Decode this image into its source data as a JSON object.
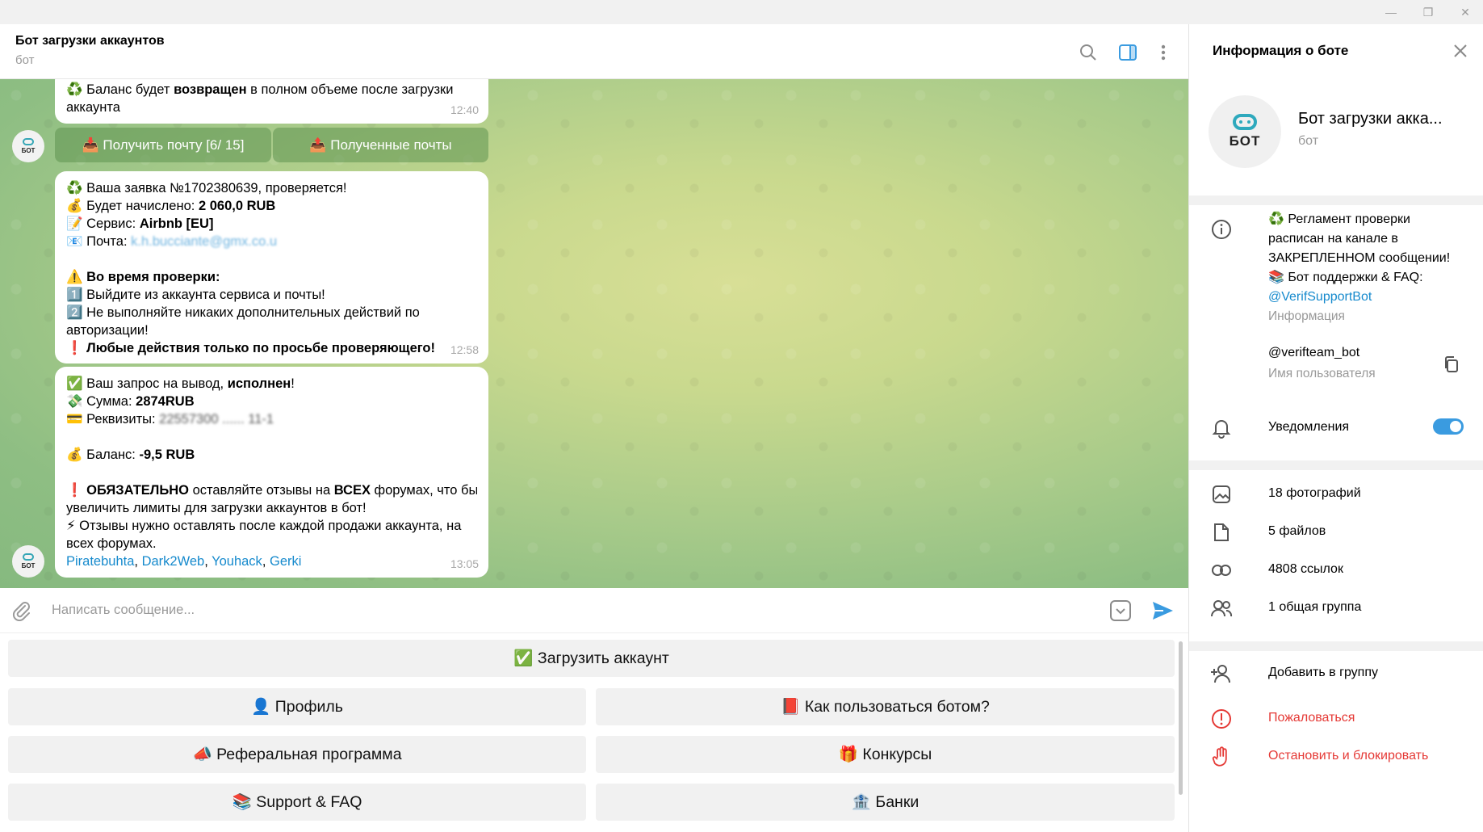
{
  "window": {
    "minimize": "—",
    "maximize": "❐",
    "close": "✕"
  },
  "header": {
    "title": "Бот загрузки аккаунтов",
    "status": "бот"
  },
  "chat": {
    "msg1": {
      "line1_emoji": "♻️",
      "line1_pre": " Баланс будет ",
      "line1_bold": "возвращен",
      "line1_post": " в полном объеме после загрузки",
      "line2": "аккаунта",
      "time": "12:40"
    },
    "inline_buttons": [
      {
        "label": "📥 Получить почту [6/ 15]"
      },
      {
        "label": "📤 Полученные почты"
      }
    ],
    "msg2": {
      "l1_pre": "♻️ Ваша заявка №1702380639, проверяется!",
      "l2_pre": "💰 Будет начислено: ",
      "l2_bold": "2 060,0 RUB",
      "l3_pre": "📝 Сервис: ",
      "l3_bold": "Airbnb [EU]",
      "l4_pre": "📧 Почта: ",
      "l4_blur": "k.h.bucciante@gmx.co.u",
      "l5_pre": "⚠️ ",
      "l5_bold": "Во время проверки:",
      "l6": "1️⃣ Выйдите из аккаунта сервиса и почты!",
      "l7": "2️⃣ Не выполняйте никаких дополнительных действий по",
      "l8": "авторизации!",
      "l9_pre": "❗ ",
      "l9_bold": "Любые действия только по просьбе проверяющего!",
      "time": "12:58"
    },
    "msg3": {
      "l1_pre": "✅ Ваш запрос на вывод, ",
      "l1_bold": "исполнен",
      "l1_post": "!",
      "l2_pre": "💸 Сумма: ",
      "l2_bold": "2874RUB",
      "l3_pre": "💳 Реквизиты: ",
      "l3_blur": "22557300 ...... 11-1",
      "l4_pre": "💰 Баланс: ",
      "l4_bold": "-9,5 RUB",
      "l5_pre": "❗ ",
      "l5_bold1": "ОБЯЗАТЕЛЬНО",
      "l5_mid": " оставляйте отзывы на ",
      "l5_bold2": "ВСЕХ",
      "l5_post": " форумах, что бы",
      "l6": "увеличить лимиты для загрузки аккаунтов в бот!",
      "l7": "⚡ Отзывы нужно оставлять после каждой продажи аккаунта, на",
      "l8": "всех форумах.",
      "links": [
        "Piratebuhta",
        "Dark2Web",
        "Youhack",
        "Gerki"
      ],
      "sep": ", ",
      "time": "13:05"
    },
    "avatar_label": "БОТ"
  },
  "composer": {
    "placeholder": "Написать сообщение..."
  },
  "keyboard": [
    {
      "label": "✅ Загрузить аккаунт"
    },
    {
      "label": "👤 Профиль"
    },
    {
      "label": "📕 Как пользоваться ботом?"
    },
    {
      "label": "📣 Реферальная программа"
    },
    {
      "label": "🎁 Конкурсы"
    },
    {
      "label": "📚 Support & FAQ"
    },
    {
      "label": "🏦 Банки"
    }
  ],
  "panel": {
    "title": "Информация о боте",
    "avatar_label": "БОТ",
    "name": "Бот загрузки акка...",
    "sub": "бот",
    "description": [
      "♻️ Регламент проверки",
      "расписан на канале в",
      "ЗАКРЕПЛЕННОМ сообщении!",
      "📚 Бот поддержки & FAQ:"
    ],
    "support_link": "@VerifSupportBot",
    "info_label": "Информация",
    "username": "@verifteam_bot",
    "username_label": "Имя пользователя",
    "notifications": "Уведомления",
    "notifications_on": true,
    "media": [
      {
        "label": "18 фотографий",
        "icon": "photo-icon"
      },
      {
        "label": "5 файлов",
        "icon": "file-icon"
      },
      {
        "label": "4808 ссылок",
        "icon": "link-icon"
      },
      {
        "label": "1 общая группа",
        "icon": "group-icon"
      }
    ],
    "add_to_group": "Добавить в группу",
    "report": "Пожаловаться",
    "block": "Остановить и блокировать"
  },
  "colors": {
    "accent": "#3a9be0",
    "link": "#168acd",
    "danger": "#e53935",
    "chat_bg": "#c9d98e"
  }
}
